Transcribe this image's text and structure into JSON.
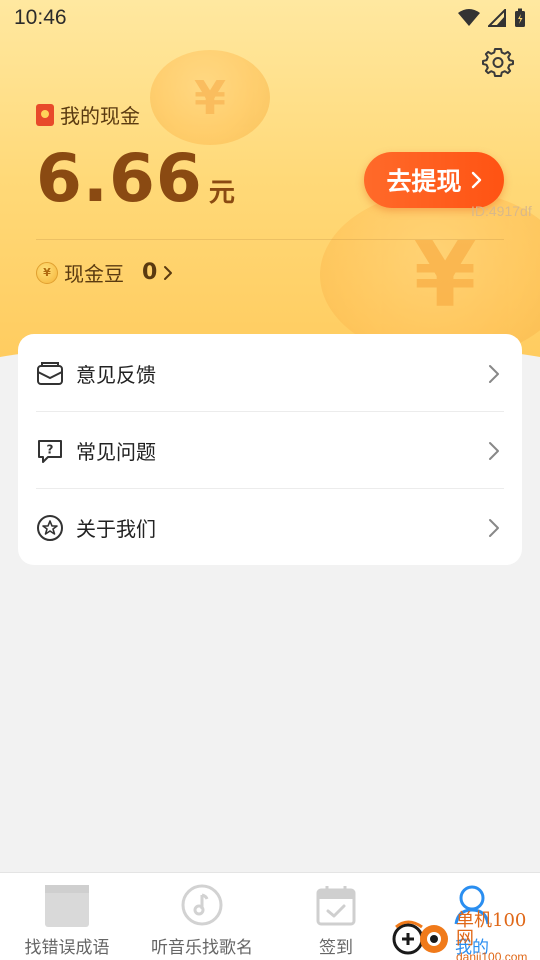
{
  "status_bar": {
    "time": "10:46"
  },
  "cash": {
    "title": "我的现金",
    "amount": "6.66",
    "unit": "元",
    "withdraw_label": "去提现",
    "id_text": "ID:4917df"
  },
  "beans": {
    "label": "现金豆",
    "value": "0"
  },
  "menu": {
    "items": [
      {
        "label": "意见反馈",
        "icon": "feedback-icon"
      },
      {
        "label": "常见问题",
        "icon": "faq-icon"
      },
      {
        "label": "关于我们",
        "icon": "about-icon"
      }
    ]
  },
  "tabbar": {
    "tabs": [
      {
        "label": "找错误成语",
        "icon": "idiom-icon"
      },
      {
        "label": "听音乐找歌名",
        "icon": "music-icon"
      },
      {
        "label": "签到",
        "icon": "calendar-icon"
      },
      {
        "label": "我的",
        "icon": "profile-icon"
      }
    ],
    "active_color": "#2a8ef0"
  },
  "watermark": {
    "title": "单机100网",
    "url": "danji100.com"
  },
  "colors": {
    "accent": "#ff5a1a",
    "hero_gradient_top": "#ffe8a0",
    "hero_gradient_bottom": "#ffc95a",
    "amount_color": "#8a4a12"
  }
}
